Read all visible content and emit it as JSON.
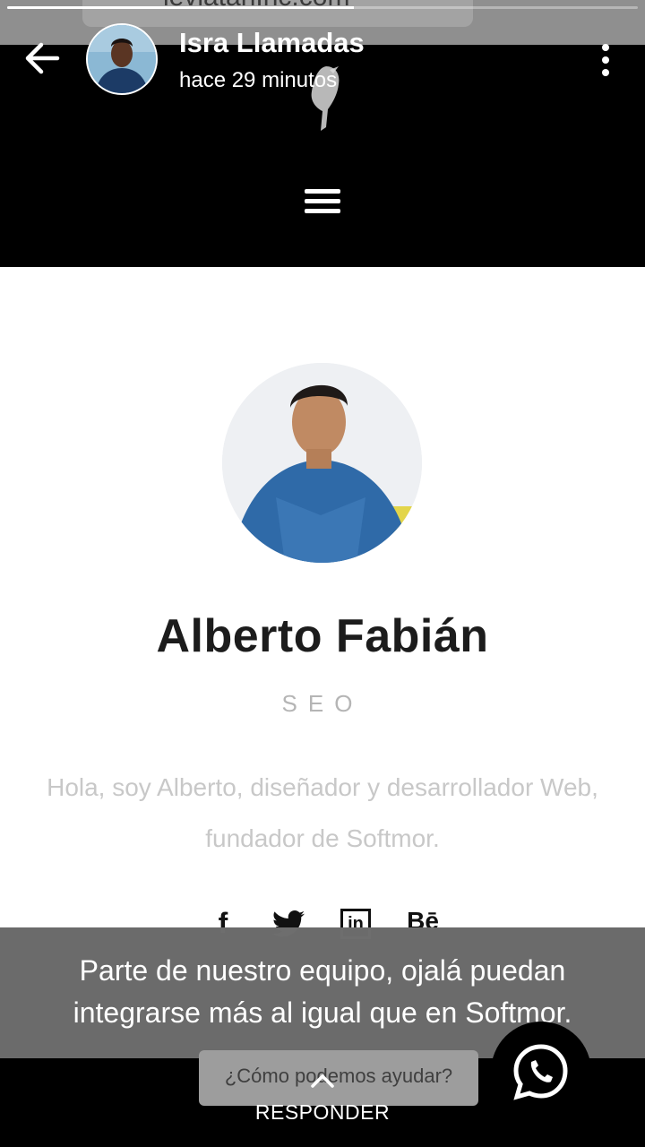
{
  "browser": {
    "url_text": "leviatanInc.com"
  },
  "story": {
    "progress": 0.55,
    "contact_name": "Isra Llamadas",
    "time_ago": "hace 29 minutos",
    "caption": "Parte de nuestro equipo, ojalá puedan integrarse más al igual que en Softmor.",
    "reply_label": "RESPONDER"
  },
  "website": {
    "profile_name": "Alberto Fabián",
    "profile_role": "SEO",
    "bio": "Hola, soy Alberto, diseñador y desarrollador Web, fundador de Softmor.",
    "social_icons": [
      "facebook-icon",
      "twitter-icon",
      "linkedin-icon",
      "behance-icon"
    ],
    "social_labels": {
      "facebook": "f",
      "linkedin": "in",
      "behance": "Bē"
    },
    "help_text": "¿Cómo podemos ayudar?"
  },
  "colors": {
    "header_bg": "#000000",
    "caption_bg": "#828282",
    "whatsapp": "#ffffff"
  }
}
